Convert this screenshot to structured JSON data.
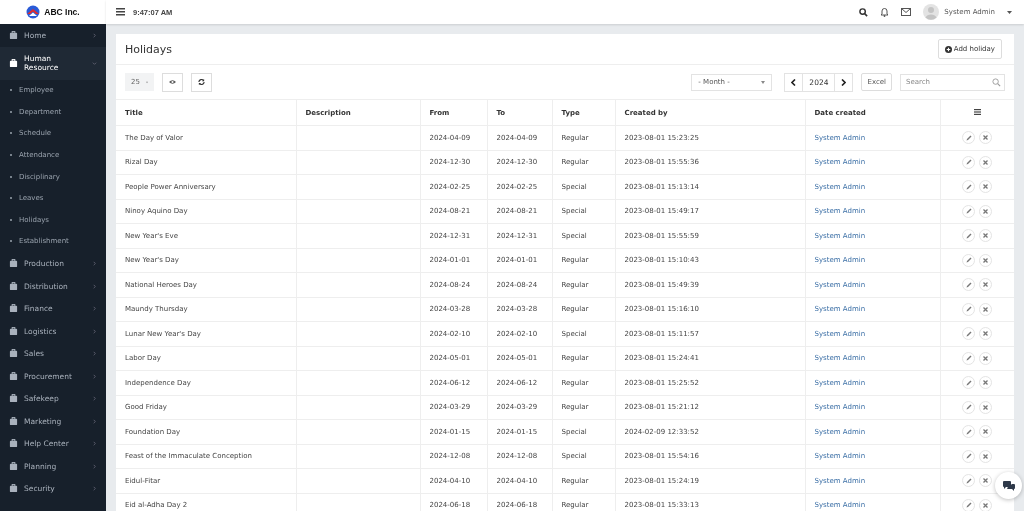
{
  "brand": {
    "name": "ABC Inc."
  },
  "topbar": {
    "time": "9:47:07 AM",
    "user": "System Admin"
  },
  "sidebar": {
    "items": [
      {
        "label": "Home",
        "expanded": false
      },
      {
        "label": "Human Resource",
        "expanded": true,
        "children": [
          {
            "label": "Employee"
          },
          {
            "label": "Department"
          },
          {
            "label": "Schedule"
          },
          {
            "label": "Attendance"
          },
          {
            "label": "Disciplinary"
          },
          {
            "label": "Leaves"
          },
          {
            "label": "Holidays"
          },
          {
            "label": "Establishment"
          }
        ]
      },
      {
        "label": "Production",
        "expanded": false
      },
      {
        "label": "Distribution",
        "expanded": false
      },
      {
        "label": "Finance",
        "expanded": false
      },
      {
        "label": "Logistics",
        "expanded": false
      },
      {
        "label": "Sales",
        "expanded": false
      },
      {
        "label": "Procurement",
        "expanded": false
      },
      {
        "label": "Safekeep",
        "expanded": false
      },
      {
        "label": "Marketing",
        "expanded": false
      },
      {
        "label": "Help Center",
        "expanded": false
      },
      {
        "label": "Planning",
        "expanded": false
      },
      {
        "label": "Security",
        "expanded": false
      }
    ]
  },
  "page": {
    "title": "Holidays",
    "add_button": "Add holiday"
  },
  "toolbar": {
    "page_size": "25",
    "month": "- Month -",
    "year": "2024",
    "excel": "Excel",
    "search_placeholder": "Search"
  },
  "table": {
    "columns": [
      "Title",
      "Description",
      "From",
      "To",
      "Type",
      "Created by",
      "Date created"
    ],
    "rows": [
      {
        "title": "The Day of Valor",
        "from": "2024-04-09",
        "to": "2024-04-09",
        "type": "Regular",
        "created_by": "2023-08-01 15:23:25",
        "date_created": "System Admin"
      },
      {
        "title": "Rizal Day",
        "from": "2024-12-30",
        "to": "2024-12-30",
        "type": "Regular",
        "created_by": "2023-08-01 15:55:36",
        "date_created": "System Admin"
      },
      {
        "title": "People Power Anniversary",
        "from": "2024-02-25",
        "to": "2024-02-25",
        "type": "Special",
        "created_by": "2023-08-01 15:13:14",
        "date_created": "System Admin"
      },
      {
        "title": "Ninoy Aquino Day",
        "from": "2024-08-21",
        "to": "2024-08-21",
        "type": "Special",
        "created_by": "2023-08-01 15:49:17",
        "date_created": "System Admin"
      },
      {
        "title": "New Year's Eve",
        "from": "2024-12-31",
        "to": "2024-12-31",
        "type": "Special",
        "created_by": "2023-08-01 15:55:59",
        "date_created": "System Admin"
      },
      {
        "title": "New Year's Day",
        "from": "2024-01-01",
        "to": "2024-01-01",
        "type": "Regular",
        "created_by": "2023-08-01 15:10:43",
        "date_created": "System Admin"
      },
      {
        "title": "National Heroes Day",
        "from": "2024-08-24",
        "to": "2024-08-24",
        "type": "Regular",
        "created_by": "2023-08-01 15:49:39",
        "date_created": "System Admin"
      },
      {
        "title": "Maundy Thursday",
        "from": "2024-03-28",
        "to": "2024-03-28",
        "type": "Regular",
        "created_by": "2023-08-01 15:16:10",
        "date_created": "System Admin"
      },
      {
        "title": "Lunar New Year's Day",
        "from": "2024-02-10",
        "to": "2024-02-10",
        "type": "Special",
        "created_by": "2023-08-01 15:11:57",
        "date_created": "System Admin"
      },
      {
        "title": "Labor Day",
        "from": "2024-05-01",
        "to": "2024-05-01",
        "type": "Regular",
        "created_by": "2023-08-01 15:24:41",
        "date_created": "System Admin"
      },
      {
        "title": "Independence Day",
        "from": "2024-06-12",
        "to": "2024-06-12",
        "type": "Regular",
        "created_by": "2023-08-01 15:25:52",
        "date_created": "System Admin"
      },
      {
        "title": "Good Friday",
        "from": "2024-03-29",
        "to": "2024-03-29",
        "type": "Regular",
        "created_by": "2023-08-01 15:21:12",
        "date_created": "System Admin"
      },
      {
        "title": "Foundation Day",
        "from": "2024-01-15",
        "to": "2024-01-15",
        "type": "Special",
        "created_by": "2024-02-09 12:33:52",
        "date_created": "System Admin"
      },
      {
        "title": "Feast of the Immaculate Conception",
        "from": "2024-12-08",
        "to": "2024-12-08",
        "type": "Special",
        "created_by": "2023-08-01 15:54:16",
        "date_created": "System Admin"
      },
      {
        "title": "Eidul-Fitar",
        "from": "2024-04-10",
        "to": "2024-04-10",
        "type": "Regular",
        "created_by": "2023-08-01 15:24:19",
        "date_created": "System Admin"
      },
      {
        "title": "Eid al-Adha Day 2",
        "from": "2024-06-18",
        "to": "2024-06-18",
        "type": "Regular",
        "created_by": "2023-08-01 15:33:13",
        "date_created": "System Admin"
      }
    ]
  }
}
